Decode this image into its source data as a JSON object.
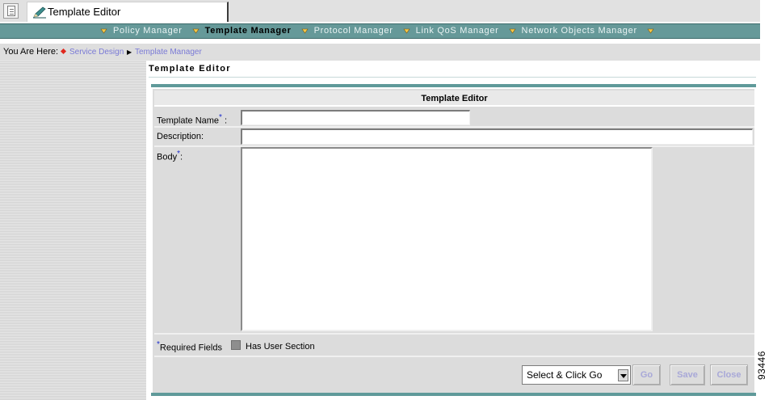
{
  "tab": {
    "title": "Template Editor"
  },
  "nav": {
    "items": [
      {
        "label": "Policy Manager",
        "active": false
      },
      {
        "label": "Template Manager",
        "active": true
      },
      {
        "label": "Protocol Manager",
        "active": false
      },
      {
        "label": "Link QoS Manager",
        "active": false
      },
      {
        "label": "Network Objects Manager",
        "active": false
      }
    ]
  },
  "breadcrumb": {
    "prefix": "You Are Here:",
    "items": [
      "Service Design",
      "Template Manager"
    ]
  },
  "page": {
    "title": "Template Editor"
  },
  "form": {
    "header": "Template Editor",
    "template_name_label": "Template Name",
    "required_mark": "*",
    "description_label": "Description:",
    "body_label": "Body",
    "template_name_value": "",
    "description_value": "",
    "body_value": ""
  },
  "footer": {
    "required_fields_label": "Required Fields",
    "has_user_section_label": "Has User Section"
  },
  "actions": {
    "select_value": "Select & Click Go",
    "go_label": "Go",
    "save_label": "Save",
    "close_label": "Close"
  },
  "figure_number": "93446",
  "colors": {
    "nav_bar": "#669999",
    "accent_teal": "#5f9a9a",
    "link": "#7a7ad6",
    "required": "#1c2ccc"
  }
}
